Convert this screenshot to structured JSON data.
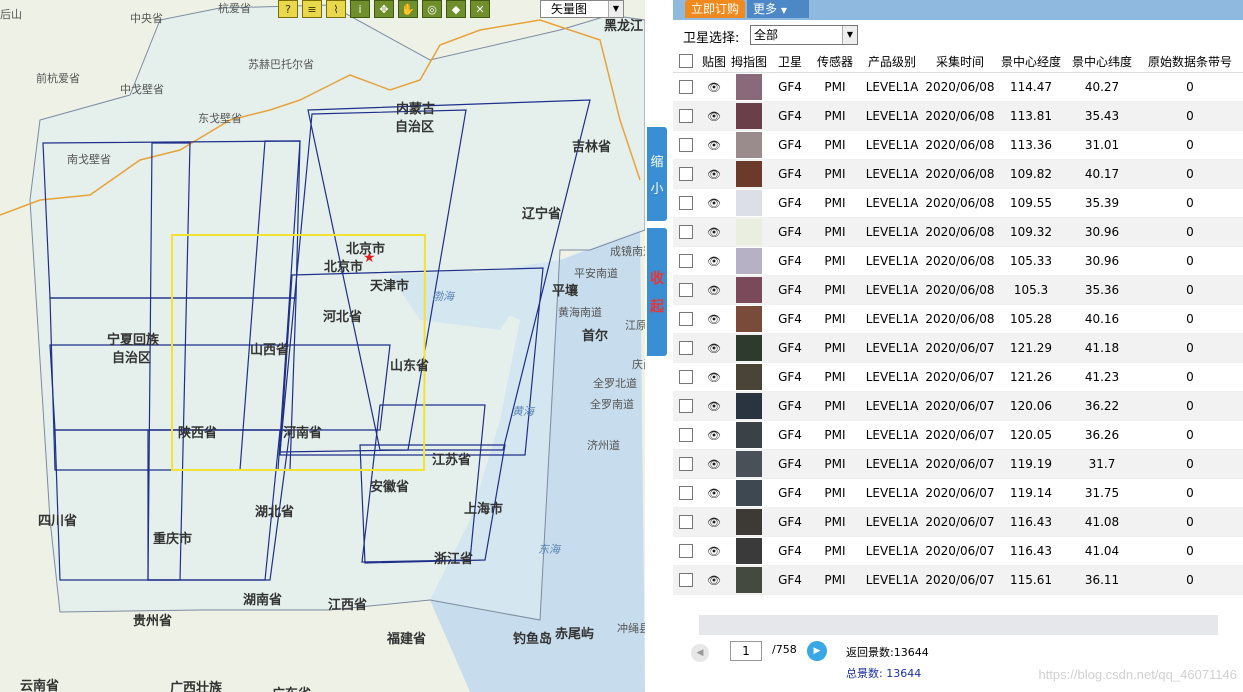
{
  "map": {
    "toolbar_icons": [
      "help-icon",
      "layers-icon",
      "measure-icon",
      "info-icon",
      "fullextent-icon",
      "pan-icon",
      "target-icon",
      "erase-icon",
      "close-icon"
    ],
    "layer_select": {
      "value": "矢量图"
    },
    "labels": [
      {
        "text": "后山",
        "cls": ""
      },
      {
        "text": "中央省",
        "cls": ""
      },
      {
        "text": "杭爱省",
        "cls": ""
      },
      {
        "text": "前杭爱省",
        "cls": ""
      },
      {
        "text": "苏赫巴托尔省",
        "cls": ""
      },
      {
        "text": "中戈壁省",
        "cls": ""
      },
      {
        "text": "东戈壁省",
        "cls": ""
      },
      {
        "text": "南戈壁省",
        "cls": ""
      },
      {
        "text": "内蒙古",
        "cls": "big"
      },
      {
        "text": "自治区",
        "cls": "big"
      },
      {
        "text": "吉林省",
        "cls": "big"
      },
      {
        "text": "辽宁省",
        "cls": "big"
      },
      {
        "text": "北京市",
        "cls": "big"
      },
      {
        "text": "北京市",
        "cls": "big"
      },
      {
        "text": "天津市",
        "cls": "big"
      },
      {
        "text": "渤海",
        "cls": "water"
      },
      {
        "text": "平壤",
        "cls": "big"
      },
      {
        "text": "河北省",
        "cls": "big"
      },
      {
        "text": "宁夏回族",
        "cls": "big"
      },
      {
        "text": "自治区",
        "cls": "big"
      },
      {
        "text": "山西省",
        "cls": "big"
      },
      {
        "text": "山东省",
        "cls": "big"
      },
      {
        "text": "陕西省",
        "cls": "big"
      },
      {
        "text": "河南省",
        "cls": "big"
      },
      {
        "text": "黄海",
        "cls": "water"
      },
      {
        "text": "江苏省",
        "cls": "big"
      },
      {
        "text": "安徽省",
        "cls": "big"
      },
      {
        "text": "四川省",
        "cls": "big"
      },
      {
        "text": "湖北省",
        "cls": "big"
      },
      {
        "text": "重庆市",
        "cls": "big"
      },
      {
        "text": "上海市",
        "cls": "big"
      },
      {
        "text": "东海",
        "cls": "water"
      },
      {
        "text": "浙江省",
        "cls": "big"
      },
      {
        "text": "湖南省",
        "cls": "big"
      },
      {
        "text": "江西省",
        "cls": "big"
      },
      {
        "text": "贵州省",
        "cls": "big"
      },
      {
        "text": "福建省",
        "cls": "big"
      },
      {
        "text": "钓鱼岛",
        "cls": "big"
      },
      {
        "text": "赤尾屿",
        "cls": "big"
      },
      {
        "text": "冲绳县",
        "cls": ""
      },
      {
        "text": "云南省",
        "cls": "big"
      },
      {
        "text": "广西壮族",
        "cls": "big"
      },
      {
        "text": "广东省",
        "cls": "big"
      },
      {
        "text": "黑龙江",
        "cls": "big"
      },
      {
        "text": "首尔",
        "cls": "big"
      },
      {
        "text": "成镜南道",
        "cls": ""
      },
      {
        "text": "平安南道",
        "cls": ""
      },
      {
        "text": "黄海南道",
        "cls": ""
      },
      {
        "text": "江原",
        "cls": ""
      },
      {
        "text": "庆尚北道",
        "cls": ""
      },
      {
        "text": "全罗北道",
        "cls": ""
      },
      {
        "text": "全罗南道",
        "cls": ""
      },
      {
        "text": "济州道",
        "cls": ""
      }
    ]
  },
  "side_tabs": {
    "shrink": [
      "缩",
      "小"
    ],
    "collapse": [
      "收",
      "起"
    ]
  },
  "panel": {
    "tabs": {
      "order": "立即订购",
      "more": "更多"
    },
    "filter_label": "卫星选择:",
    "satellite_select": "全部",
    "columns": [
      "",
      "贴图",
      "拇指图",
      "卫星",
      "传感器",
      "产品级别",
      "采集时间",
      "景中心经度",
      "景中心纬度",
      "原始数据条带号"
    ],
    "rows": [
      {
        "sat": "GF4",
        "sensor": "PMI",
        "level": "LEVEL1A",
        "date": "2020/06/08",
        "lon": "114.47",
        "lat": "40.27",
        "strip": "0",
        "thumb": "#8a6a7a"
      },
      {
        "sat": "GF4",
        "sensor": "PMI",
        "level": "LEVEL1A",
        "date": "2020/06/08",
        "lon": "113.81",
        "lat": "35.43",
        "strip": "0",
        "thumb": "#6b3f4a"
      },
      {
        "sat": "GF4",
        "sensor": "PMI",
        "level": "LEVEL1A",
        "date": "2020/06/08",
        "lon": "113.36",
        "lat": "31.01",
        "strip": "0",
        "thumb": "#9a8c8c"
      },
      {
        "sat": "GF4",
        "sensor": "PMI",
        "level": "LEVEL1A",
        "date": "2020/06/08",
        "lon": "109.82",
        "lat": "40.17",
        "strip": "0",
        "thumb": "#6c3a2a"
      },
      {
        "sat": "GF4",
        "sensor": "PMI",
        "level": "LEVEL1A",
        "date": "2020/06/08",
        "lon": "109.55",
        "lat": "35.39",
        "strip": "0",
        "thumb": "#dcdfe8"
      },
      {
        "sat": "GF4",
        "sensor": "PMI",
        "level": "LEVEL1A",
        "date": "2020/06/08",
        "lon": "109.32",
        "lat": "30.96",
        "strip": "0",
        "thumb": "#e9eee0"
      },
      {
        "sat": "GF4",
        "sensor": "PMI",
        "level": "LEVEL1A",
        "date": "2020/06/08",
        "lon": "105.33",
        "lat": "30.96",
        "strip": "0",
        "thumb": "#b7b1c6"
      },
      {
        "sat": "GF4",
        "sensor": "PMI",
        "level": "LEVEL1A",
        "date": "2020/06/08",
        "lon": "105.3",
        "lat": "35.36",
        "strip": "0",
        "thumb": "#7a4a5a"
      },
      {
        "sat": "GF4",
        "sensor": "PMI",
        "level": "LEVEL1A",
        "date": "2020/06/08",
        "lon": "105.28",
        "lat": "40.16",
        "strip": "0",
        "thumb": "#7a4a3a"
      },
      {
        "sat": "GF4",
        "sensor": "PMI",
        "level": "LEVEL1A",
        "date": "2020/06/07",
        "lon": "121.29",
        "lat": "41.18",
        "strip": "0",
        "thumb": "#2e3a2e"
      },
      {
        "sat": "GF4",
        "sensor": "PMI",
        "level": "LEVEL1A",
        "date": "2020/06/07",
        "lon": "121.26",
        "lat": "41.23",
        "strip": "0",
        "thumb": "#4a4436"
      },
      {
        "sat": "GF4",
        "sensor": "PMI",
        "level": "LEVEL1A",
        "date": "2020/06/07",
        "lon": "120.06",
        "lat": "36.22",
        "strip": "0",
        "thumb": "#2a3440"
      },
      {
        "sat": "GF4",
        "sensor": "PMI",
        "level": "LEVEL1A",
        "date": "2020/06/07",
        "lon": "120.05",
        "lat": "36.26",
        "strip": "0",
        "thumb": "#3a4248"
      },
      {
        "sat": "GF4",
        "sensor": "PMI",
        "level": "LEVEL1A",
        "date": "2020/06/07",
        "lon": "119.19",
        "lat": "31.7",
        "strip": "0",
        "thumb": "#4a5058"
      },
      {
        "sat": "GF4",
        "sensor": "PMI",
        "level": "LEVEL1A",
        "date": "2020/06/07",
        "lon": "119.14",
        "lat": "31.75",
        "strip": "0",
        "thumb": "#3e4850"
      },
      {
        "sat": "GF4",
        "sensor": "PMI",
        "level": "LEVEL1A",
        "date": "2020/06/07",
        "lon": "116.43",
        "lat": "41.08",
        "strip": "0",
        "thumb": "#3d3a36"
      },
      {
        "sat": "GF4",
        "sensor": "PMI",
        "level": "LEVEL1A",
        "date": "2020/06/07",
        "lon": "116.43",
        "lat": "41.04",
        "strip": "0",
        "thumb": "#3a3a3a"
      },
      {
        "sat": "GF4",
        "sensor": "PMI",
        "level": "LEVEL1A",
        "date": "2020/06/07",
        "lon": "115.61",
        "lat": "36.11",
        "strip": "0",
        "thumb": "#454a40"
      }
    ],
    "pager": {
      "page": "1",
      "total_pages": "/758",
      "returned": "返回景数:13644",
      "total": "总景数:  13644"
    }
  },
  "watermark": "https://blog.csdn.net/qq_46071146"
}
